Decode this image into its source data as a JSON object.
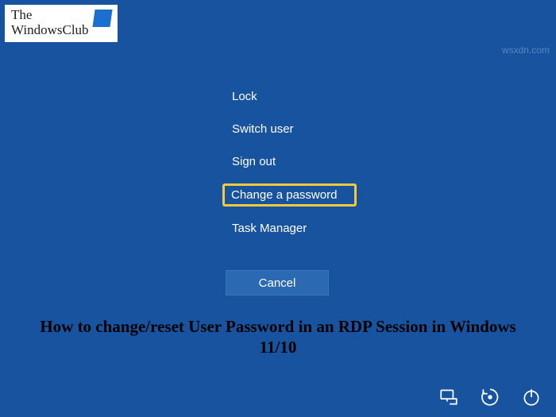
{
  "logo": {
    "line1": "The",
    "line2": "WindowsClub"
  },
  "watermark": "wsxdn.com",
  "menu": {
    "items": [
      {
        "label": "Lock"
      },
      {
        "label": "Switch user"
      },
      {
        "label": "Sign out"
      },
      {
        "label": "Change a password"
      },
      {
        "label": "Task Manager"
      }
    ]
  },
  "cancel_label": "Cancel",
  "caption": "How to change/reset User Password in an RDP Session in Windows 11/10",
  "icons": {
    "network": "network-icon",
    "ease": "ease-of-access-icon",
    "power": "power-icon"
  }
}
